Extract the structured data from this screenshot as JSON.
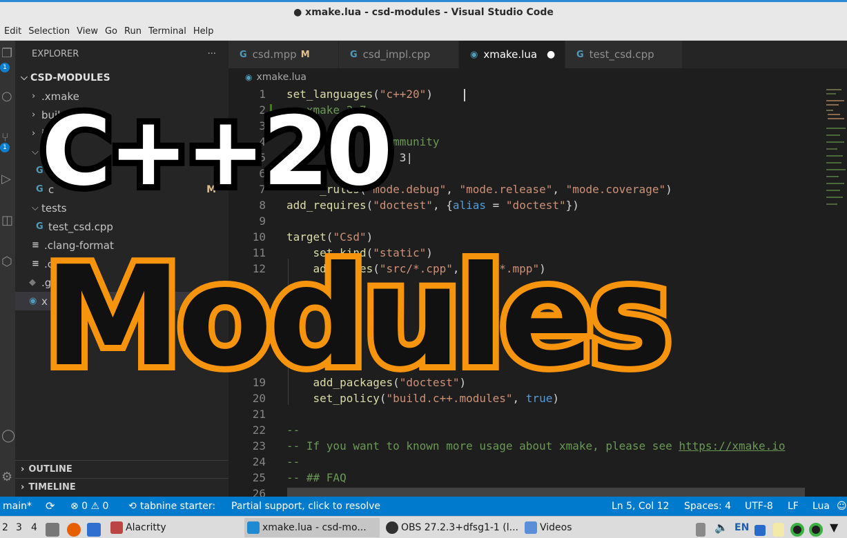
{
  "window": {
    "title": "● xmake.lua - csd-modules - Visual Studio Code"
  },
  "menu": [
    "Edit",
    "Selection",
    "View",
    "Go",
    "Run",
    "Terminal",
    "Help"
  ],
  "activity_badges": [
    "1",
    "1"
  ],
  "explorer": {
    "header": "EXPLORER",
    "more": "···",
    "root": "CSD-MODULES",
    "items": [
      {
        "label": ".xmake",
        "type": "folder"
      },
      {
        "label": "build",
        "type": "folder"
      },
      {
        "label": "i",
        "type": "folder"
      },
      {
        "label": "",
        "type": "folder-open"
      },
      {
        "label": "",
        "type": "file"
      },
      {
        "label": "c",
        "type": "file",
        "modified": "M"
      },
      {
        "label": "tests",
        "type": "folder-open"
      },
      {
        "label": "test_csd.cpp",
        "type": "file"
      },
      {
        "label": ".clang-format",
        "type": "file"
      },
      {
        "label": ".cl",
        "type": "file"
      },
      {
        "label": ".g",
        "type": "file"
      },
      {
        "label": "x",
        "type": "file"
      }
    ],
    "outline": "OUTLINE",
    "timeline": "TIMELINE"
  },
  "tabs": [
    {
      "label": "csd.mpp",
      "modified": "M"
    },
    {
      "label": "csd_impl.cpp"
    },
    {
      "label": "xmake.lua",
      "dirty": "●"
    },
    {
      "label": "test_csd.cpp"
    }
  ],
  "breadcrumb": "xmake.lua",
  "editor": {
    "lines": [
      {
        "n": "1",
        "tokens": [
          [
            "fn",
            "set_languages"
          ],
          [
            "pn",
            "("
          ],
          [
            "str",
            "\"c++20\""
          ],
          [
            "pn",
            ")"
          ]
        ]
      },
      {
        "n": "2",
        "tokens": [
          [
            "cmt",
            "-- xmake 2.7"
          ]
        ]
      },
      {
        "n": "3",
        "tokens": []
      },
      {
        "n": "4",
        "tokens": [
          [
            "cmt",
            "                mmunity"
          ]
        ]
      },
      {
        "n": "5",
        "tokens": [
          [
            "pn",
            "                 3|"
          ]
        ]
      },
      {
        "n": "6",
        "tokens": []
      },
      {
        "n": "7",
        "tokens": [
          [
            "fn",
            "     _rules"
          ],
          [
            "pn",
            "("
          ],
          [
            "str",
            "\"mode.debug\""
          ],
          [
            "pn",
            ", "
          ],
          [
            "str",
            "\"mode.release\""
          ],
          [
            "pn",
            ", "
          ],
          [
            "str",
            "\"mode.coverage\""
          ],
          [
            "pn",
            ")"
          ]
        ]
      },
      {
        "n": "8",
        "tokens": [
          [
            "fn",
            "add_requires"
          ],
          [
            "pn",
            "("
          ],
          [
            "str",
            "\"doctest\""
          ],
          [
            "pn",
            ", {"
          ],
          [
            "kw",
            "alias"
          ],
          [
            "pn",
            " = "
          ],
          [
            "str",
            "\"doctest\""
          ],
          [
            "pn",
            "})"
          ]
        ]
      },
      {
        "n": "9",
        "tokens": []
      },
      {
        "n": "10",
        "tokens": [
          [
            "fn",
            "target"
          ],
          [
            "pn",
            "("
          ],
          [
            "str",
            "\"Csd\""
          ],
          [
            "pn",
            ")"
          ]
        ]
      },
      {
        "n": "11",
        "tokens": [
          [
            "fn",
            "    set_kind"
          ],
          [
            "pn",
            "("
          ],
          [
            "str",
            "\"static\""
          ],
          [
            "pn",
            ")"
          ]
        ]
      },
      {
        "n": "12",
        "tokens": [
          [
            "fn",
            "    add_files"
          ],
          [
            "pn",
            "("
          ],
          [
            "str",
            "\"src/*.cpp\""
          ],
          [
            "pn",
            ", "
          ],
          [
            "str",
            "\"src/*.mpp\""
          ],
          [
            "pn",
            ")"
          ]
        ]
      },
      {
        "n": "19",
        "tokens": [
          [
            "fn",
            "    add_packages"
          ],
          [
            "pn",
            "("
          ],
          [
            "str",
            "\"doctest\""
          ],
          [
            "pn",
            ")"
          ]
        ]
      },
      {
        "n": "20",
        "tokens": [
          [
            "fn",
            "    set_policy"
          ],
          [
            "pn",
            "("
          ],
          [
            "str",
            "\"build.c++.modules\""
          ],
          [
            "pn",
            ", "
          ],
          [
            "kw",
            "true"
          ],
          [
            "pn",
            ")"
          ]
        ]
      },
      {
        "n": "21",
        "tokens": []
      },
      {
        "n": "22",
        "tokens": [
          [
            "cmt",
            "--"
          ]
        ]
      },
      {
        "n": "23",
        "tokens": [
          [
            "cmt",
            "-- If you want to known more usage about xmake, please see "
          ],
          [
            "link",
            "https://xmake.io"
          ]
        ]
      },
      {
        "n": "24",
        "tokens": [
          [
            "cmt",
            "--"
          ]
        ]
      },
      {
        "n": "25",
        "tokens": [
          [
            "cmt",
            "-- ## FAQ"
          ]
        ]
      },
      {
        "n": "26",
        "tokens": [
          [
            "cmt",
            "--"
          ]
        ]
      }
    ]
  },
  "statusbar": {
    "branch": "main*",
    "errors": "⊗ 0 ⚠ 0",
    "tabnine": "tabnine starter:",
    "message": "Partial support, click to resolve",
    "position": "Ln 5, Col 12",
    "spaces": "Spaces: 4",
    "encoding": "UTF-8",
    "eol": "LF",
    "language": "Lua"
  },
  "taskbar": {
    "workspaces": [
      "2",
      "3",
      "4"
    ],
    "tasks": [
      {
        "label": "Alacritty"
      },
      {
        "label": "xmake.lua - csd-mo..."
      },
      {
        "label": "OBS 27.2.3+dfsg1-1 (l..."
      },
      {
        "label": "Videos"
      }
    ],
    "lang": "EN"
  },
  "overlay": {
    "line1": "C++20",
    "line2": "Modules"
  },
  "colors": {
    "accent": "#007acc",
    "overlay_orange": "#f7940e"
  }
}
